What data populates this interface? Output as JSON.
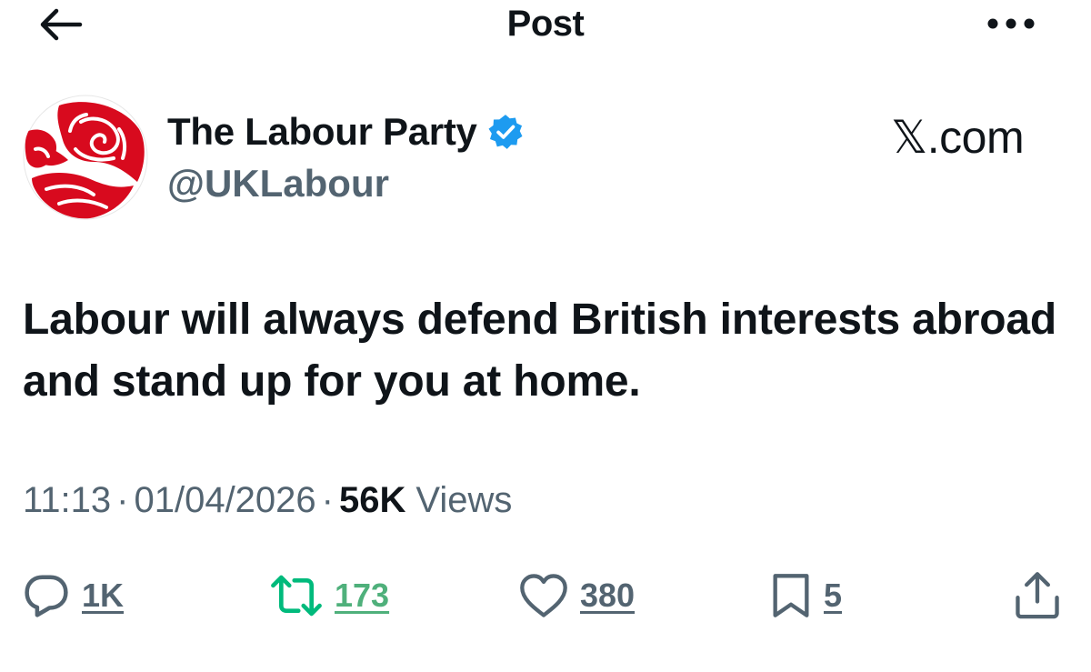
{
  "header": {
    "title": "Post",
    "back_icon": "arrow-left-icon",
    "more_icon": "more-horizontal-icon"
  },
  "author": {
    "display_name": "The Labour Party",
    "handle": "@UKLabour",
    "verified": true,
    "avatar_icon": "labour-rose-logo",
    "brand_color": "#d50000",
    "verified_color": "#1d9bf0"
  },
  "site_mark": "𝕏.com",
  "post": {
    "text": "Labour will always defend British interests abroad and stand up for you at home."
  },
  "meta": {
    "time": "11:13",
    "date": "01/04/2026",
    "views_count": "56K",
    "views_label": "Views",
    "separator": "·"
  },
  "actions": {
    "reply": {
      "icon": "reply-bubble-icon",
      "count": "1K"
    },
    "repost": {
      "icon": "repost-icon",
      "count": "173",
      "color": "#00ba7c"
    },
    "like": {
      "icon": "heart-icon",
      "count": "380"
    },
    "bookmark": {
      "icon": "bookmark-icon",
      "count": "5"
    },
    "share": {
      "icon": "share-icon"
    }
  }
}
